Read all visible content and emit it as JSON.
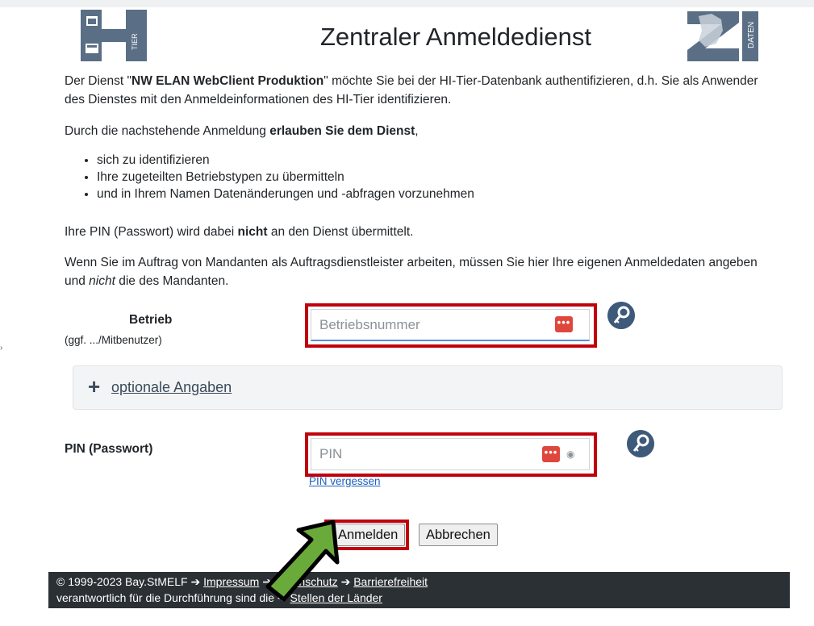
{
  "header": {
    "title": "Zentraler Anmeldedienst",
    "logo_left_text": "TIER",
    "logo_right_text": "DATEN"
  },
  "intro": {
    "line1_pre": "Der Dienst \"",
    "service_name": "NW ELAN WebClient Produktion",
    "line1_post": "\" möchte Sie bei der HI-Tier-Datenbank authentifizieren, d.h. Sie als Anwender des Dienstes mit den Anmeldeinformationen des HI-Tier identifizieren.",
    "consent_pre": "Durch die nachstehende Anmeldung ",
    "consent_bold": "erlauben Sie dem Dienst",
    "consent_post": ",",
    "permissions": [
      "sich zu identifizieren",
      "Ihre zugeteilten Betriebstypen zu übermitteln",
      "und in Ihrem Namen Datenänderungen und -abfragen vorzunehmen"
    ],
    "pin_pre": "Ihre PIN (Passwort) wird dabei ",
    "pin_bold": "nicht",
    "pin_post": " an den Dienst übermittelt.",
    "mandant_pre": "Wenn Sie im Auftrag von Mandanten als Auftragsdienstleister arbeiten, müssen Sie hier Ihre eigenen Anmeldedaten angeben und ",
    "mandant_italic": "nicht",
    "mandant_post": " die des Mandanten."
  },
  "form": {
    "betrieb_label": "Betrieb",
    "betrieb_sublabel": "(ggf. .../Mitbenutzer)",
    "betrieb_placeholder": "Betriebsnummer",
    "betrieb_value": "",
    "optional_label": "optionale Angaben",
    "pin_label": "PIN (Passwort)",
    "pin_placeholder": "PIN",
    "pin_value": "",
    "pin_forgot": "PIN vergessen",
    "password_manager_glyph": "•••",
    "eye_glyph": "◉",
    "plus_glyph": "+",
    "submit_label": "Anmelden",
    "cancel_label": "Abbrechen"
  },
  "footer": {
    "copyright": "© 1999-2023 Bay.StMELF",
    "arrow": "➔",
    "impressum": "Impressum",
    "datenschutz": "Datenschutz",
    "barrierefreiheit": "Barrierefreiheit",
    "line2": "verantwortlich für die Durchführung sind die",
    "stellen": "Stellen der Länder"
  },
  "left_marker": "›",
  "colors": {
    "highlight": "#c0000c",
    "arrow": "#6aaa3a",
    "footer_bg": "#2b3035",
    "password_manager": "#e0473c",
    "key_icon_bg": "#3e5a7a"
  },
  "icons": [
    "hi-tier-logo",
    "zi-daten-logo",
    "password-manager-icon",
    "key-icon",
    "eye-icon",
    "plus-icon",
    "arrow-right-icon",
    "green-arrow-annotation"
  ]
}
